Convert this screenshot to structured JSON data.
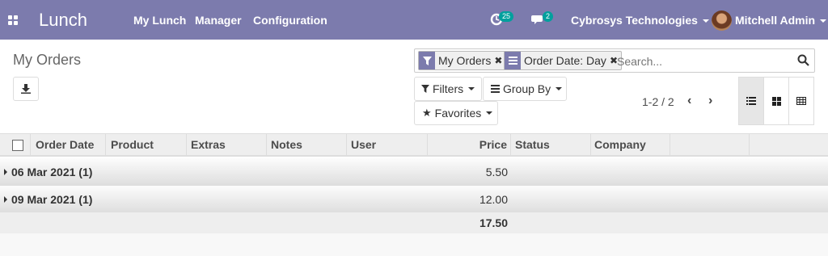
{
  "navbar": {
    "app_name": "Lunch",
    "menu": [
      "My Lunch",
      "Manager",
      "Configuration"
    ],
    "activity_count": "25",
    "message_count": "2",
    "company": "Cybrosys Technologies",
    "user": "Mitchell Admin",
    "color": "#7c7bad"
  },
  "control_panel": {
    "title": "My Orders",
    "search": {
      "facets": [
        {
          "icon": "filter-icon",
          "label": "My Orders"
        },
        {
          "icon": "group-icon",
          "label": "Order Date: Day"
        }
      ],
      "placeholder": "Search..."
    },
    "filters_label": "Filters",
    "groupby_label": "Group By",
    "favorites_label": "Favorites",
    "pager": "1-2 / 2",
    "views": [
      "list-view-icon",
      "kanban-view-icon",
      "pivot-view-icon"
    ],
    "active_view": "list"
  },
  "table": {
    "columns": [
      "Order Date",
      "Product",
      "Extras",
      "Notes",
      "User",
      "Price",
      "Status",
      "Company"
    ],
    "groups": [
      {
        "label": "06 Mar 2021 (1)",
        "price": "5.50"
      },
      {
        "label": "09 Mar 2021 (1)",
        "price": "12.00"
      }
    ],
    "total_price": "17.50"
  }
}
